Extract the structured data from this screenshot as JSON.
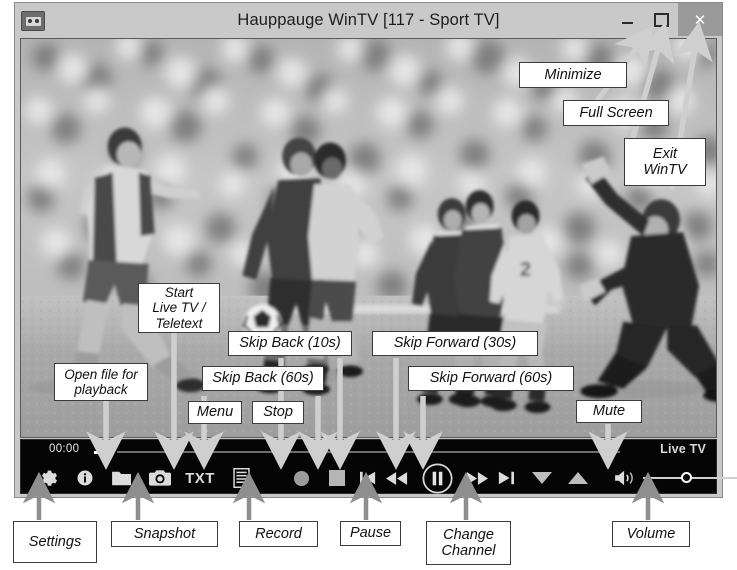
{
  "window": {
    "title": "Hauppauge WinTV [117 - Sport TV]",
    "app_icon": "tv-icon",
    "buttons": {
      "minimize": "minimize-icon",
      "maximize": "maximize-icon",
      "close": "✕"
    }
  },
  "video": {
    "description": "Black and white blurred photograph of a soccer match with players and a goalkeeper"
  },
  "toolbar": {
    "time": "00:00",
    "status": "Live TV",
    "buttons": [
      {
        "name": "settings",
        "icon": "gear-icon",
        "label": "Settings"
      },
      {
        "name": "info",
        "icon": "info-icon",
        "label": "Info"
      },
      {
        "name": "open-file",
        "icon": "folder-icon",
        "label": "Open file for playback"
      },
      {
        "name": "snapshot",
        "icon": "camera-icon",
        "label": "Snapshot"
      },
      {
        "name": "teletext",
        "icon": "txt-icon",
        "label": "TXT"
      },
      {
        "name": "menu",
        "icon": "menu-icon",
        "label": "Menu"
      },
      {
        "name": "record",
        "icon": "record-icon",
        "label": "Record"
      },
      {
        "name": "stop",
        "icon": "stop-icon",
        "label": "Stop"
      },
      {
        "name": "skip-back-60",
        "icon": "skip-back-icon",
        "label": "Skip Back (60s)"
      },
      {
        "name": "skip-back-10",
        "icon": "rewind-icon",
        "label": "Skip Back (10s)"
      },
      {
        "name": "pause",
        "icon": "pause-icon",
        "label": "Pause"
      },
      {
        "name": "skip-fwd-30",
        "icon": "fast-forward-icon",
        "label": "Skip Forward (30s)"
      },
      {
        "name": "skip-fwd-60",
        "icon": "skip-forward-icon",
        "label": "Skip Forward (60s)"
      },
      {
        "name": "channel-down",
        "icon": "triangle-down-icon",
        "label": "Change Channel"
      },
      {
        "name": "channel-up",
        "icon": "triangle-up-icon",
        "label": "Change Channel"
      },
      {
        "name": "mute",
        "icon": "speaker-icon",
        "label": "Mute"
      }
    ],
    "volume": {
      "name": "volume-slider",
      "label": "Volume",
      "value": 33
    }
  },
  "callouts": [
    {
      "id": "minimize",
      "text": "Minimize"
    },
    {
      "id": "fullscreen",
      "text": "Full Screen"
    },
    {
      "id": "exit",
      "line1": "Exit",
      "line2": "WinTV"
    },
    {
      "id": "start-live-tv",
      "line1": "Start",
      "line2": "Live TV /",
      "line3": "Teletext"
    },
    {
      "id": "open-file",
      "line1": "Open file for",
      "line2": "playback"
    },
    {
      "id": "skip-back-10",
      "text": "Skip Back (10s)"
    },
    {
      "id": "skip-back-60",
      "text": "Skip Back (60s)"
    },
    {
      "id": "skip-fwd-30",
      "text": "Skip Forward (30s)"
    },
    {
      "id": "skip-fwd-60",
      "text": "Skip Forward (60s)"
    },
    {
      "id": "menu",
      "text": "Menu"
    },
    {
      "id": "stop",
      "text": "Stop"
    },
    {
      "id": "mute",
      "text": "Mute"
    },
    {
      "id": "settings",
      "text": "Settings"
    },
    {
      "id": "snapshot",
      "text": "Snapshot"
    },
    {
      "id": "record",
      "text": "Record"
    },
    {
      "id": "pause",
      "text": "Pause"
    },
    {
      "id": "change-channel",
      "line1": "Change",
      "line2": "Channel"
    },
    {
      "id": "volume",
      "text": "Volume"
    }
  ],
  "colors": {
    "window_chrome": "#c9c9c9",
    "toolbar_bg": "#050505",
    "close_button": "#9a9a9a",
    "callout_border": "#3c3c3c",
    "arrow": "#c6c6c6",
    "arrow_dark": "#8e8e8e"
  }
}
